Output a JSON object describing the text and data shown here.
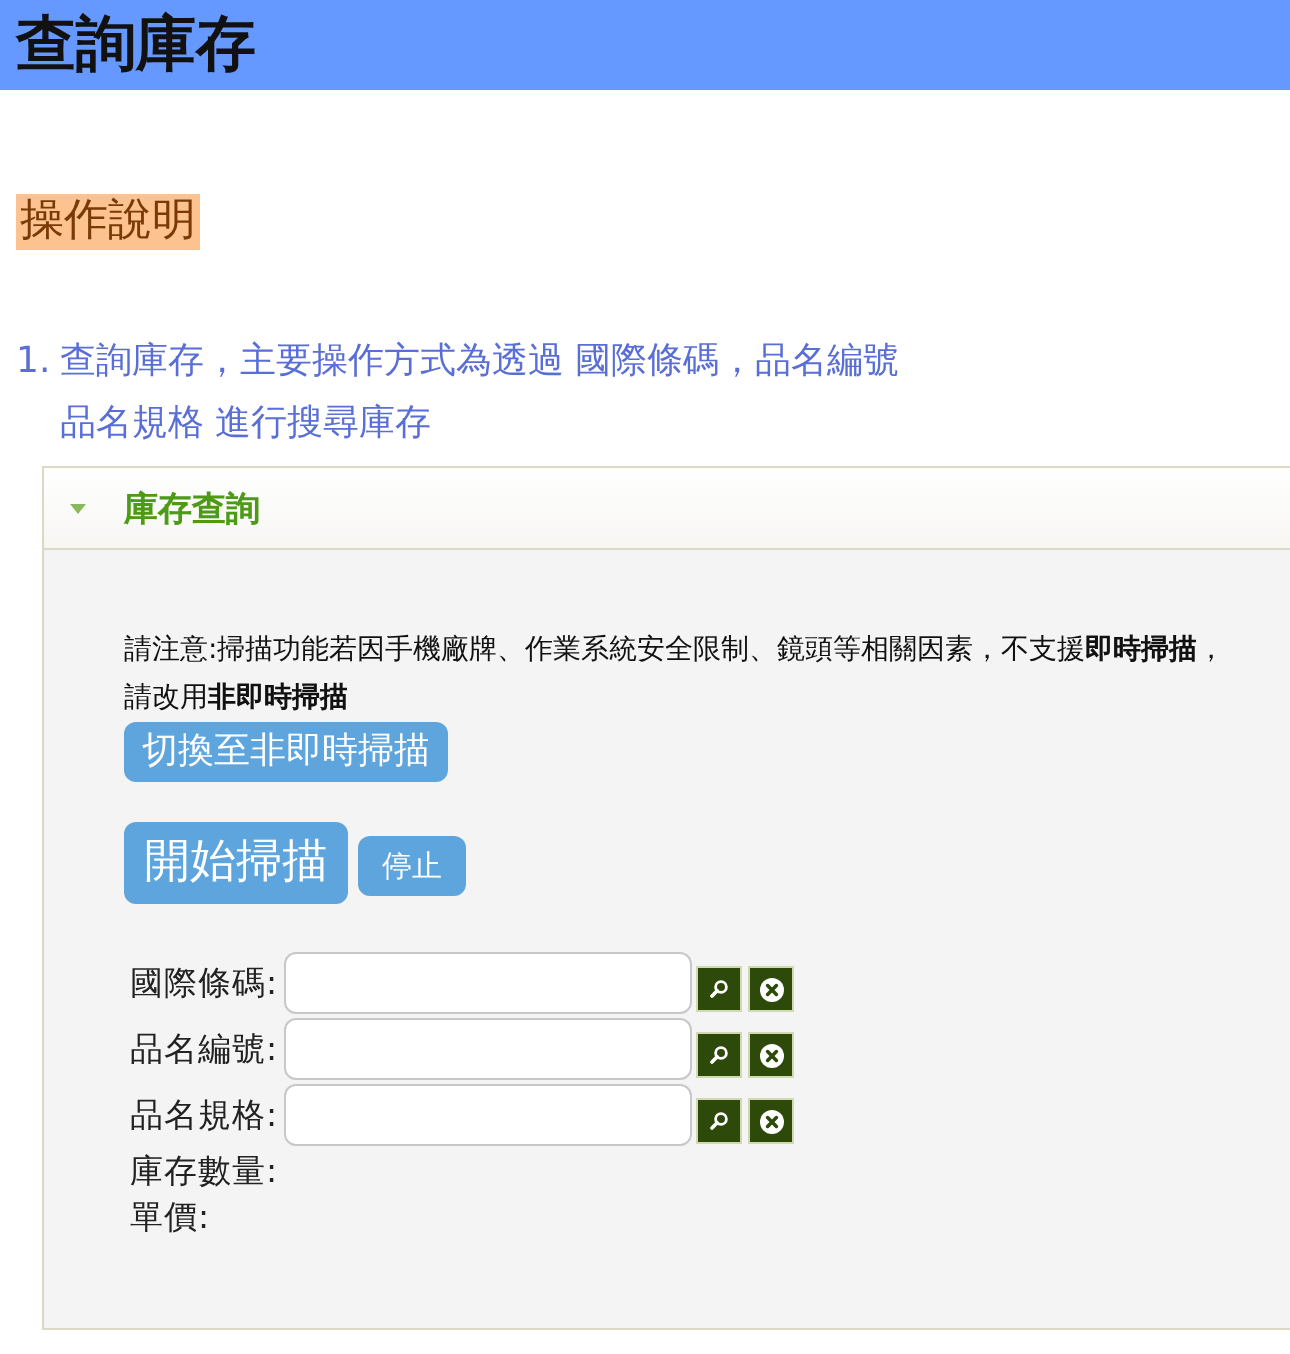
{
  "header": {
    "title": "查詢庫存"
  },
  "instructions": {
    "heading": "操作說明",
    "items": [
      {
        "number": "1.",
        "text": "查詢庫存，主要操作方式為透過 國際條碼，品名編號品名規格 進行搜尋庫存"
      }
    ]
  },
  "panel": {
    "title": "庫存查詢",
    "expanded": true,
    "notice": [
      "請注意:掃描功能若因手機廠牌、作業系統安全限制、鏡頭等相關因素，不支援**即時掃描**，",
      "請改用**非即時掃描**"
    ],
    "mode_button": "切換至非即時掃描",
    "scan_buttons": [
      {
        "kind": "start",
        "label": "開始掃描"
      },
      {
        "kind": "stop",
        "label": "停止"
      }
    ],
    "fields": [
      {
        "kind": "input",
        "label": "國際條碼:"
      },
      {
        "kind": "input",
        "label": "品名編號:"
      },
      {
        "kind": "input",
        "label": "品名規格:"
      },
      {
        "kind": "output",
        "label": "庫存數量:"
      },
      {
        "kind": "output",
        "label": "單價:"
      }
    ]
  }
}
